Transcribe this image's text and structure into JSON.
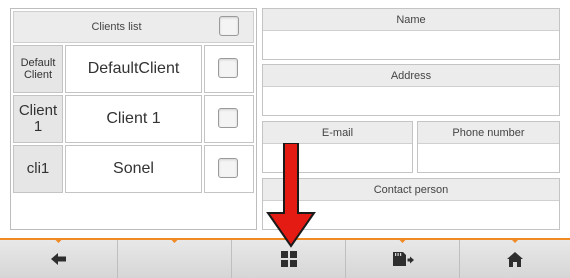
{
  "clients_list": {
    "header": "Clients list",
    "rows": [
      {
        "abbr": "Default Client",
        "name": "DefaultClient",
        "abbr_size": "11px"
      },
      {
        "abbr": "Client 1",
        "name": "Client 1",
        "abbr_size": "15px"
      },
      {
        "abbr": "cli1",
        "name": "Sonel",
        "abbr_size": "15px"
      }
    ]
  },
  "form": {
    "name_label": "Name",
    "address_label": "Address",
    "email_label": "E-mail",
    "phone_label": "Phone number",
    "contact_label": "Contact person"
  },
  "bottom_bar": {
    "accent_color": "#f08a24",
    "buttons": [
      {
        "id": "back",
        "icon": "arrow-left-icon"
      },
      {
        "id": "empty",
        "icon": ""
      },
      {
        "id": "grid",
        "icon": "grid-icon"
      },
      {
        "id": "sd-card",
        "icon": "sd-card-export-icon"
      },
      {
        "id": "home",
        "icon": "home-icon"
      }
    ]
  },
  "annotation": {
    "arrow_color": "#e31b12"
  }
}
